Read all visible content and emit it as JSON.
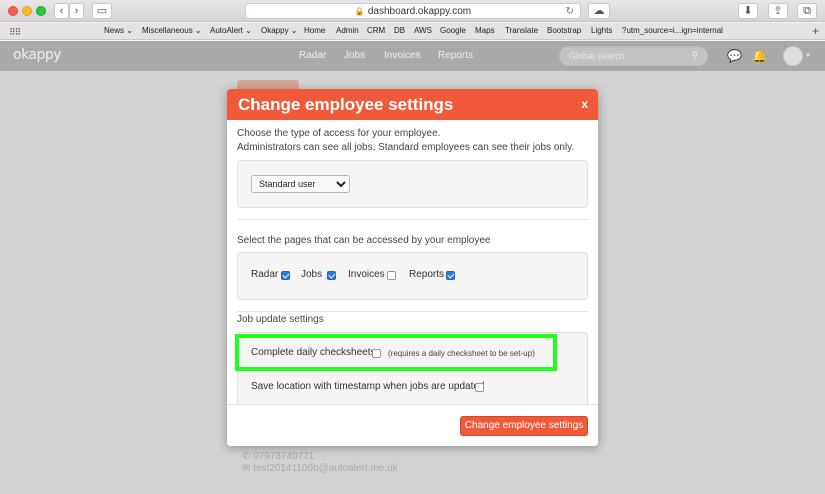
{
  "browser": {
    "url": "dashboard.okappy.com",
    "bookmarks": [
      "News",
      "Miscellaneous",
      "AutoAlert",
      "Okappy",
      "Home",
      "Admin",
      "CRM",
      "DB",
      "AWS",
      "Google",
      "Maps",
      "Translate",
      "Bootstrap",
      "Lights",
      "?utm_source=i...ign=internal"
    ]
  },
  "header": {
    "logo": "okappy",
    "nav": [
      "Radar",
      "Jobs",
      "Invoices",
      "Reports"
    ],
    "search_placeholder": "Global search"
  },
  "background": {
    "phone": "07973740771",
    "email": "test20141106b@autoalert.me.uk"
  },
  "modal": {
    "title": "Change employee settings",
    "close": "x",
    "access_intro_1": "Choose the type of access for your employee.",
    "access_intro_2": "Administrators can see all jobs, Standard employees can see their jobs only.",
    "access_options": [
      "Standard user"
    ],
    "access_selected": "Standard user",
    "pages_intro": "Select the pages that can be accessed by your employee",
    "pages": [
      {
        "label": "Radar",
        "checked": true
      },
      {
        "label": "Jobs",
        "checked": true
      },
      {
        "label": "Invoices",
        "checked": false
      },
      {
        "label": "Reports",
        "checked": true
      }
    ],
    "job_update_heading": "Job update settings",
    "checksheets_label": "Complete daily checksheets",
    "checksheets_note": "(requires a daily checksheet to be set-up)",
    "checksheets_checked": false,
    "location_label": "Save location with timestamp when jobs are updated",
    "location_checked": false,
    "save_label": "Change employee settings"
  },
  "colors": {
    "accent": "#f05a3a",
    "highlight": "#1fff1a",
    "checkbox_on": "#2a7ae2"
  }
}
